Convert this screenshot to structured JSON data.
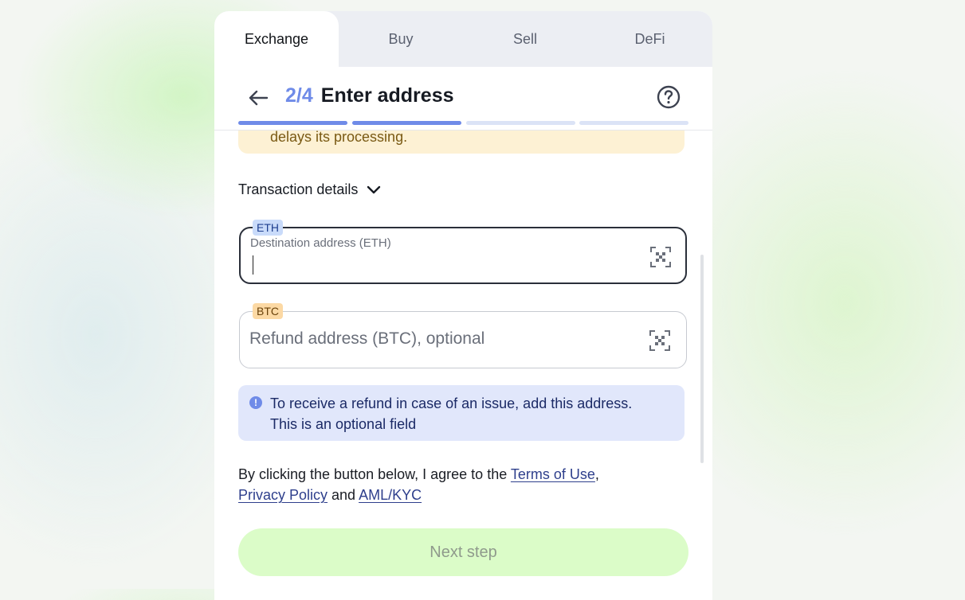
{
  "tabs": [
    {
      "label": "Exchange",
      "active": true
    },
    {
      "label": "Buy",
      "active": false
    },
    {
      "label": "Sell",
      "active": false
    },
    {
      "label": "DeFi",
      "active": false
    }
  ],
  "header": {
    "step": "2/4",
    "title": "Enter address",
    "back_icon": "arrow-left-icon",
    "help_icon": "question-circle-icon",
    "progress": {
      "current": 2,
      "total": 4
    }
  },
  "warning": {
    "text": "delays its processing."
  },
  "transaction_details": {
    "label": "Transaction details",
    "icon": "chevron-down-icon"
  },
  "destination": {
    "chip": "ETH",
    "label": "Destination address (ETH)",
    "value": "",
    "icon": "qr-scan-icon"
  },
  "refund": {
    "chip": "BTC",
    "placeholder": "Refund address (BTC), optional",
    "icon": "qr-scan-icon"
  },
  "info": {
    "icon": "info-icon",
    "glyph": "!",
    "line1": "To receive a refund in case of an issue, add this address.",
    "line2": "This is an optional field"
  },
  "terms": {
    "prefix": "By clicking the button below, I agree to the ",
    "terms_link": "Terms of Use",
    "comma": ",",
    "privacy_link": "Privacy Policy",
    "and": " and ",
    "aml_link": "AML/KYC"
  },
  "next_button": {
    "label": "Next step",
    "enabled": false
  },
  "colors": {
    "accent": "#6f8be8",
    "warning_bg": "#fdf1d4",
    "info_bg": "#e1e7fb",
    "button_bg": "#dbfcc8",
    "eth_chip": "#c9dbfa",
    "btc_chip": "#fcd9a4"
  }
}
